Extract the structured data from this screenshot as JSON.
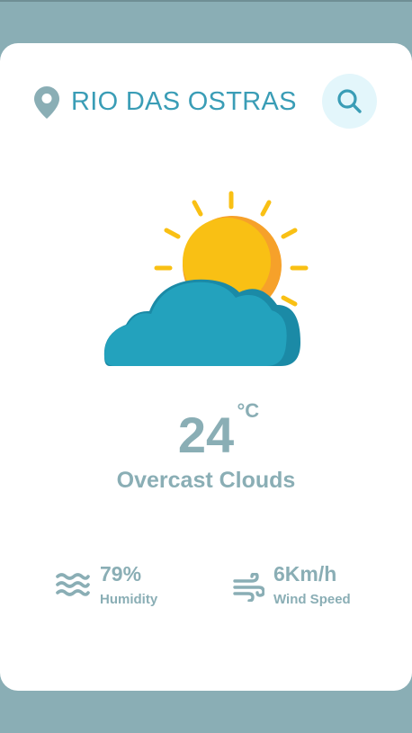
{
  "location": {
    "city": "RIO DAS OSTRAS",
    "icon": "map-pin-icon"
  },
  "search": {
    "icon": "search-icon"
  },
  "weather": {
    "icon": "sun-behind-cloud-icon",
    "temperature": "24",
    "unit": "°C",
    "description": "Overcast Clouds"
  },
  "stats": {
    "humidity": {
      "value": "79%",
      "label": "Humidity",
      "icon": "waves-icon"
    },
    "wind": {
      "value": "6Km/h",
      "label": "Wind Speed",
      "icon": "wind-icon"
    }
  },
  "colors": {
    "background": "#8aaeb5",
    "accent": "#3a9db6",
    "text_muted": "#8aaeb5",
    "search_bg": "#e3f6fb",
    "sun": "#f9c014",
    "sun_shade": "#f6a12a",
    "cloud": "#23a2bd",
    "cloud_shade": "#1b8aa6"
  }
}
